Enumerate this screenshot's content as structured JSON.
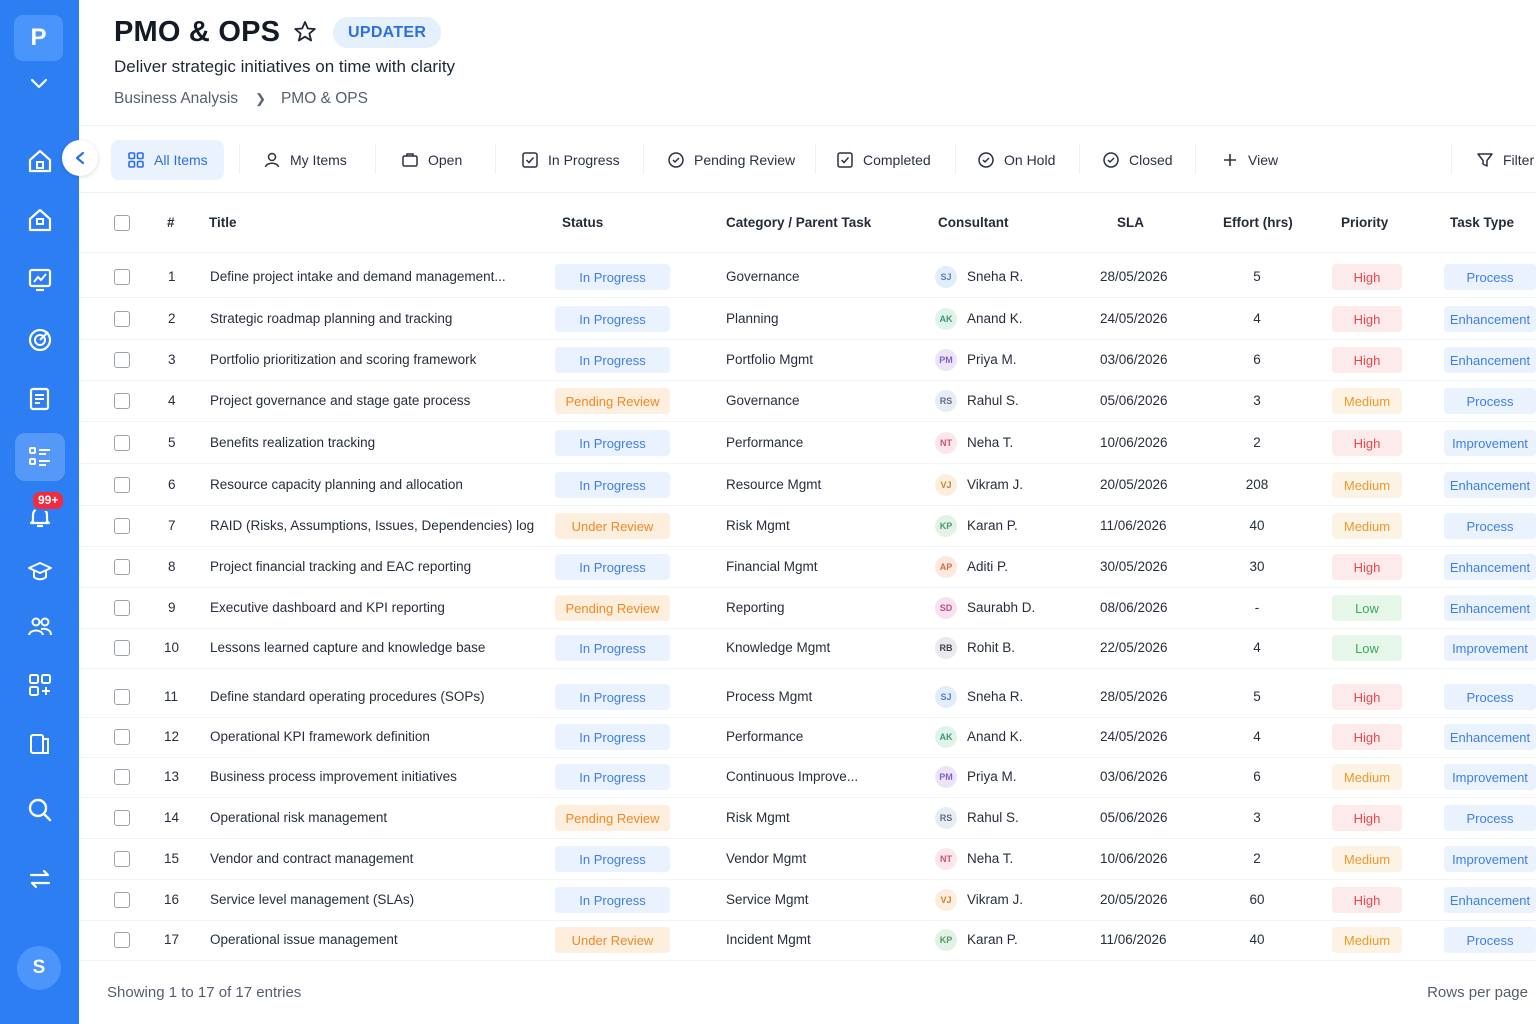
{
  "app": {
    "logo_letter": "P",
    "user_initial": "S",
    "notification_count": "99+"
  },
  "header": {
    "title": "PMO & OPS",
    "tag": "UPDATER",
    "subtitle": "Deliver strategic initiatives on time with clarity",
    "breadcrumb": [
      "Business Analysis",
      "PMO & OPS"
    ]
  },
  "sidebar": {
    "icons": [
      "home-icon",
      "building-icon",
      "chart-icon",
      "target-icon",
      "report-icon",
      "list-icon",
      "bell-icon",
      "graduation-icon",
      "team-icon",
      "apps-icon",
      "documents-icon",
      "search-icon",
      "swap-icon"
    ]
  },
  "tabs": [
    {
      "label": "All Items",
      "icon": "grid-icon"
    },
    {
      "label": "My Items",
      "icon": "user-icon"
    },
    {
      "label": "Open",
      "icon": "folder-icon"
    },
    {
      "label": "In Progress",
      "icon": "checkbox-icon"
    },
    {
      "label": "Pending Review",
      "icon": "check-circle-icon"
    },
    {
      "label": "Completed",
      "icon": "checkbox-icon"
    },
    {
      "label": "On Hold",
      "icon": "check-circle-icon"
    },
    {
      "label": "Closed",
      "icon": "check-circle-icon"
    },
    {
      "label": "View",
      "icon": "plus-icon"
    },
    {
      "label": "Filter",
      "icon": "filter-icon"
    }
  ],
  "columns": [
    "#",
    "Title",
    "Status",
    "Category / Parent Task",
    "Consultant",
    "SLA",
    "Effort (hrs)",
    "Priority",
    "Task Type"
  ],
  "rows": [
    {
      "n": "1",
      "title": "Define project intake and demand management...",
      "status": "In Progress",
      "category": "Governance",
      "initials": "SJ",
      "consultant": "Sneha R.",
      "sla": "28/05/2026",
      "effort": "5",
      "priority": "High",
      "type": "Process"
    },
    {
      "n": "2",
      "title": "Strategic roadmap planning and tracking",
      "status": "In Progress",
      "category": "Planning",
      "initials": "AK",
      "consultant": "Anand K.",
      "sla": "24/05/2026",
      "effort": "4",
      "priority": "High",
      "type": "Enhancement"
    },
    {
      "n": "3",
      "title": "Portfolio prioritization and scoring framework",
      "status": "In Progress",
      "category": "Portfolio Mgmt",
      "initials": "PM",
      "consultant": "Priya M.",
      "sla": "03/06/2026",
      "effort": "6",
      "priority": "High",
      "type": "Enhancement"
    },
    {
      "n": "4",
      "title": "Project governance and stage gate process",
      "status": "Pending Review",
      "category": "Governance",
      "initials": "RS",
      "consultant": "Rahul S.",
      "sla": "05/06/2026",
      "effort": "3",
      "priority": "Medium",
      "type": "Process"
    },
    {
      "n": "5",
      "title": "Benefits realization tracking",
      "status": "In Progress",
      "category": "Performance",
      "initials": "NT",
      "consultant": "Neha T.",
      "sla": "10/06/2026",
      "effort": "2",
      "priority": "High",
      "type": "Improvement"
    },
    {
      "n": "6",
      "title": "Resource capacity planning and allocation",
      "status": "In Progress",
      "category": "Resource Mgmt",
      "initials": "VJ",
      "consultant": "Vikram J.",
      "sla": "20/05/2026",
      "effort": "208",
      "priority": "Medium",
      "type": "Enhancement"
    },
    {
      "n": "7",
      "title": "RAID (Risks, Assumptions, Issues, Dependencies) log",
      "status": "Under Review",
      "category": "Risk Mgmt",
      "initials": "KP",
      "consultant": "Karan P.",
      "sla": "11/06/2026",
      "effort": "40",
      "priority": "Medium",
      "type": "Process"
    },
    {
      "n": "8",
      "title": "Project financial tracking and EAC reporting",
      "status": "In Progress",
      "category": "Financial Mgmt",
      "initials": "AP",
      "consultant": "Aditi P.",
      "sla": "30/05/2026",
      "effort": "30",
      "priority": "High",
      "type": "Enhancement"
    },
    {
      "n": "9",
      "title": "Executive dashboard and KPI reporting",
      "status": "Pending Review",
      "category": "Reporting",
      "initials": "SD",
      "consultant": "Saurabh D.",
      "sla": "08/06/2026",
      "effort": "-",
      "priority": "Low",
      "type": "Enhancement"
    },
    {
      "n": "10",
      "title": "Lessons learned capture and knowledge base",
      "status": "In Progress",
      "category": "Knowledge Mgmt",
      "initials": "RB",
      "consultant": "Rohit B.",
      "sla": "22/05/2026",
      "effort": "4",
      "priority": "Low",
      "type": "Improvement"
    },
    {
      "n": "11",
      "title": "Define standard operating procedures (SOPs)",
      "status": "In Progress",
      "category": "Process Mgmt",
      "initials": "SJ",
      "consultant": "Sneha R.",
      "sla": "28/05/2026",
      "effort": "5",
      "priority": "High",
      "type": "Process"
    },
    {
      "n": "12",
      "title": "Operational KPI framework definition",
      "status": "In Progress",
      "category": "Performance",
      "initials": "AK",
      "consultant": "Anand K.",
      "sla": "24/05/2026",
      "effort": "4",
      "priority": "High",
      "type": "Enhancement"
    },
    {
      "n": "13",
      "title": "Business process improvement initiatives",
      "status": "In Progress",
      "category": "Continuous Improve...",
      "initials": "PM",
      "consultant": "Priya M.",
      "sla": "03/06/2026",
      "effort": "6",
      "priority": "Medium",
      "type": "Improvement"
    },
    {
      "n": "14",
      "title": "Operational risk management",
      "status": "Pending Review",
      "category": "Risk Mgmt",
      "initials": "RS",
      "consultant": "Rahul S.",
      "sla": "05/06/2026",
      "effort": "3",
      "priority": "High",
      "type": "Process"
    },
    {
      "n": "15",
      "title": "Vendor and contract management",
      "status": "In Progress",
      "category": "Vendor Mgmt",
      "initials": "NT",
      "consultant": "Neha T.",
      "sla": "10/06/2026",
      "effort": "2",
      "priority": "Medium",
      "type": "Improvement"
    },
    {
      "n": "16",
      "title": "Service level management (SLAs)",
      "status": "In Progress",
      "category": "Service Mgmt",
      "initials": "VJ",
      "consultant": "Vikram J.",
      "sla": "20/05/2026",
      "effort": "60",
      "priority": "High",
      "type": "Enhancement"
    },
    {
      "n": "17",
      "title": "Operational issue management",
      "status": "Under Review",
      "category": "Incident Mgmt",
      "initials": "KP",
      "consultant": "Karan P.",
      "sla": "11/06/2026",
      "effort": "40",
      "priority": "Medium",
      "type": "Process"
    }
  ],
  "footer": {
    "showing": "Showing 1 to 17 of 17 entries",
    "rows_per_page": "Rows per page"
  },
  "colors": {
    "sidebar": "#2d7ef2",
    "accent": "#2d6fe0",
    "high": "#e5484d",
    "medium": "#eb9a2a",
    "low": "#3ba85a",
    "pending": "#ec8a26"
  }
}
